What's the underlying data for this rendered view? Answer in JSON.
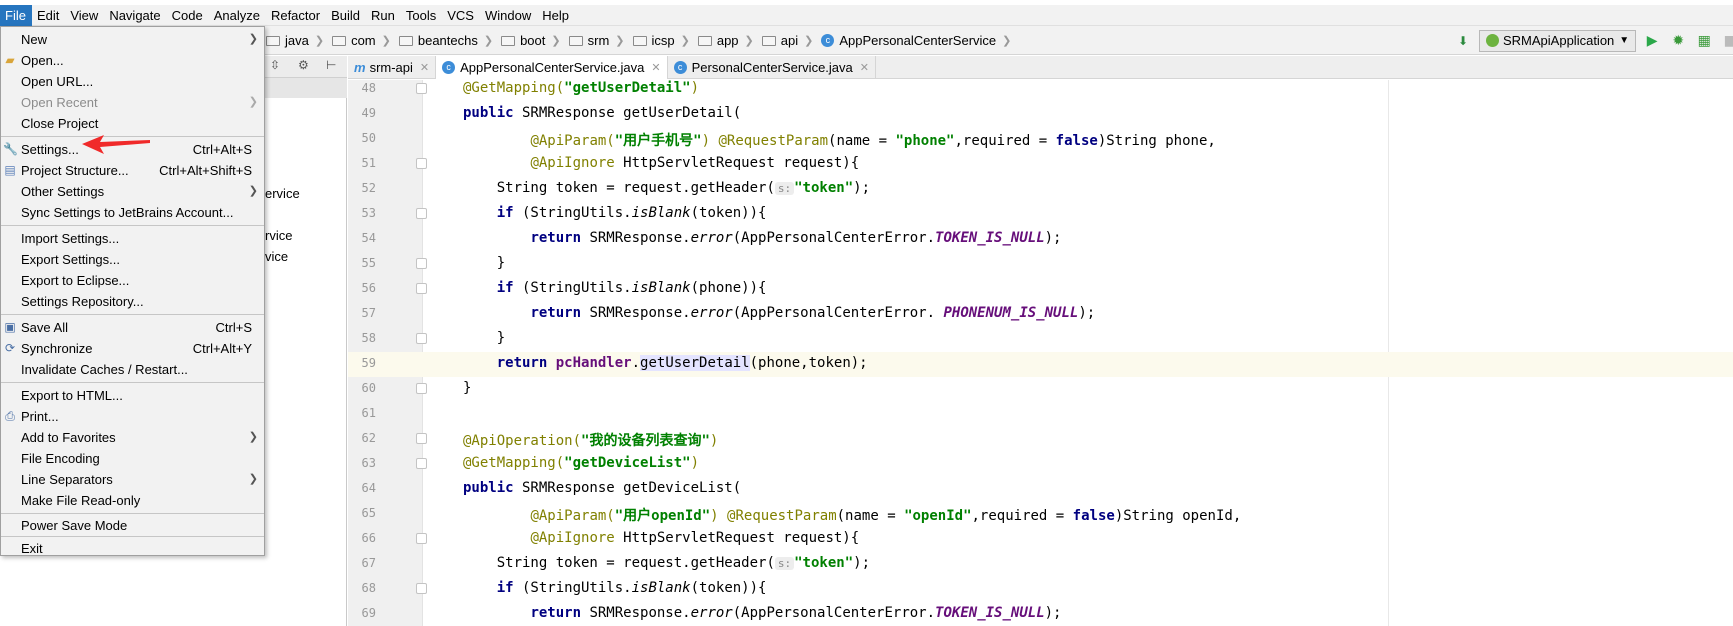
{
  "menubar": {
    "items": [
      "File",
      "Edit",
      "View",
      "Navigate",
      "Code",
      "Analyze",
      "Refactor",
      "Build",
      "Run",
      "Tools",
      "VCS",
      "Window",
      "Help"
    ]
  },
  "breadcrumb": [
    "java",
    "com",
    "beantechs",
    "boot",
    "srm",
    "icsp",
    "app",
    "api",
    "AppPersonalCenterService"
  ],
  "run_config": {
    "label": "SRMApiApplication"
  },
  "tabs": [
    {
      "label": "srm-api",
      "active": false
    },
    {
      "label": "AppPersonalCenterService.java",
      "active": true
    },
    {
      "label": "PersonalCenterService.java",
      "active": false
    }
  ],
  "project_tree": {
    "visible_fragments": [
      "ervice",
      "rvice",
      "vice"
    ]
  },
  "file_menu": {
    "items": [
      {
        "label": "New",
        "shortcut": "",
        "submenu": true,
        "disabled": false,
        "icon": ""
      },
      {
        "label": "Open...",
        "shortcut": "",
        "submenu": false,
        "disabled": false,
        "icon": "folder-open-icon"
      },
      {
        "label": "Open URL...",
        "shortcut": "",
        "submenu": false,
        "disabled": false,
        "icon": ""
      },
      {
        "label": "Open Recent",
        "shortcut": "",
        "submenu": true,
        "disabled": true,
        "icon": ""
      },
      {
        "label": "Close Project",
        "shortcut": "",
        "submenu": false,
        "disabled": false,
        "icon": ""
      },
      {
        "label": "Settings...",
        "shortcut": "Ctrl+Alt+S",
        "submenu": false,
        "disabled": false,
        "icon": "wrench-icon"
      },
      {
        "label": "Project Structure...",
        "shortcut": "Ctrl+Alt+Shift+S",
        "submenu": false,
        "disabled": false,
        "icon": "project-structure-icon"
      },
      {
        "label": "Other Settings",
        "shortcut": "",
        "submenu": true,
        "disabled": false,
        "icon": ""
      },
      {
        "label": "Sync Settings to JetBrains Account...",
        "shortcut": "",
        "submenu": false,
        "disabled": false,
        "icon": ""
      },
      {
        "label": "Import Settings...",
        "shortcut": "",
        "submenu": false,
        "disabled": false,
        "icon": ""
      },
      {
        "label": "Export Settings...",
        "shortcut": "",
        "submenu": false,
        "disabled": false,
        "icon": ""
      },
      {
        "label": "Export to Eclipse...",
        "shortcut": "",
        "submenu": false,
        "disabled": false,
        "icon": ""
      },
      {
        "label": "Settings Repository...",
        "shortcut": "",
        "submenu": false,
        "disabled": false,
        "icon": ""
      },
      {
        "label": "Save All",
        "shortcut": "Ctrl+S",
        "submenu": false,
        "disabled": false,
        "icon": "save-icon"
      },
      {
        "label": "Synchronize",
        "shortcut": "Ctrl+Alt+Y",
        "submenu": false,
        "disabled": false,
        "icon": "sync-icon"
      },
      {
        "label": "Invalidate Caches / Restart...",
        "shortcut": "",
        "submenu": false,
        "disabled": false,
        "icon": ""
      },
      {
        "label": "Export to HTML...",
        "shortcut": "",
        "submenu": false,
        "disabled": false,
        "icon": ""
      },
      {
        "label": "Print...",
        "shortcut": "",
        "submenu": false,
        "disabled": false,
        "icon": "print-icon"
      },
      {
        "label": "Add to Favorites",
        "shortcut": "",
        "submenu": true,
        "disabled": false,
        "icon": ""
      },
      {
        "label": "File Encoding",
        "shortcut": "",
        "submenu": false,
        "disabled": false,
        "icon": ""
      },
      {
        "label": "Line Separators",
        "shortcut": "",
        "submenu": true,
        "disabled": false,
        "icon": ""
      },
      {
        "label": "Make File Read-only",
        "shortcut": "",
        "submenu": false,
        "disabled": false,
        "icon": ""
      },
      {
        "label": "Power Save Mode",
        "shortcut": "",
        "submenu": false,
        "disabled": false,
        "icon": ""
      },
      {
        "label": "Exit",
        "shortcut": "",
        "submenu": false,
        "disabled": false,
        "icon": ""
      }
    ]
  },
  "code": {
    "line_numbers": [
      "48",
      "49",
      "50",
      "51",
      "52",
      "53",
      "54",
      "55",
      "56",
      "57",
      "58",
      "59",
      "60",
      "61",
      "62",
      "63",
      "64",
      "65",
      "66",
      "67",
      "68",
      "69"
    ],
    "current_line": "59",
    "t": {
      "l48a": "@GetMapping(",
      "l48b": "\"getUserDetail\"",
      "l48c": ")",
      "public": "public",
      "l49": " SRMResponse getUserDetail(",
      "apiParam": "@ApiParam(",
      "l50b": "\"用户手机号\"",
      "rp": ")",
      "requestParam": "@RequestParam",
      "nameEq": "(name = ",
      "l50phone": "\"phone\"",
      "reqEq": ",required = ",
      "false": "false",
      "l50e": ")String phone,",
      "apiIgnore": "@ApiIgnore",
      "reqTail": " HttpServletRequest request){",
      "strTok": "String token = request.getHeader(",
      "hint": "s:",
      "tokenStr": "\"token\"",
      "endP": ");",
      "if": "if",
      "blankA": " (StringUtils.",
      "isBlank": "isBlank",
      "blankTok": "(token)){",
      "return": "return",
      "srmErr": " SRMResponse.",
      "error": "error",
      "pceA": "(AppPersonalCenterError.",
      "tokenNull": "TOKEN_IS_NULL",
      "close": "}",
      "blankPhone": "(phone)){",
      "pceB": "(AppPersonalCenterError. ",
      "phoneNull": "PHONENUM_IS_NULL",
      "pcHandler": "pcHandler",
      "dot": ".",
      "getUserDetail": "getUserDetail",
      "l59tail": "(phone,token);",
      "apiOp": "@ApiOperation(",
      "l62b": "\"我的设备列表查询\"",
      "l63b": "\"getDeviceList\"",
      "l64": " SRMResponse getDeviceList(",
      "l65b": "\"用户openId\"",
      "l65open": "\"openId\"",
      "l65e": ")String openId,"
    }
  }
}
